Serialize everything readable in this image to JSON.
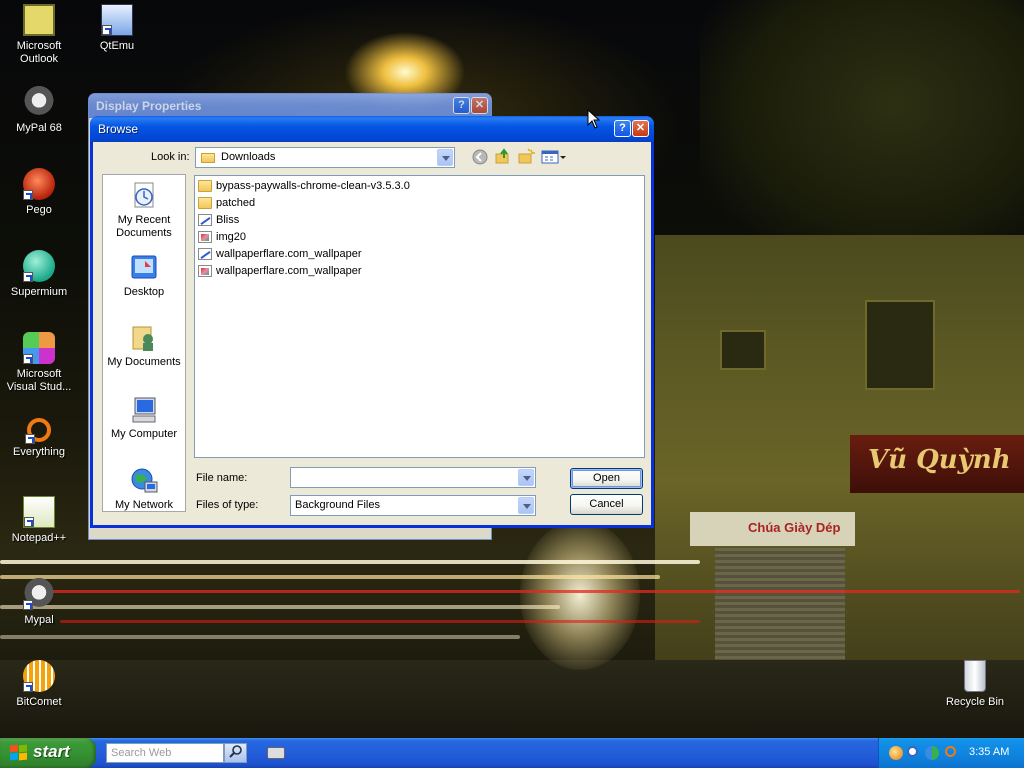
{
  "desktop": {
    "icons": [
      {
        "label": "Microsoft\nOutlook"
      },
      {
        "label": "QtEmu"
      },
      {
        "label": "MyPal 68"
      },
      {
        "label": "Pego"
      },
      {
        "label": "Supermium"
      },
      {
        "label": "Microsoft\nVisual Stud..."
      },
      {
        "label": "Everything"
      },
      {
        "label": "Notepad++"
      },
      {
        "label": "Mypal"
      },
      {
        "label": "BitComet"
      },
      {
        "label": "Recycle Bin"
      }
    ],
    "wallpaper_signs": {
      "shop_name": "Vũ Quỳnh",
      "shop_sign": "Chúa Giày Dép"
    }
  },
  "background_window": {
    "title": "Display Properties"
  },
  "dialog": {
    "title": "Browse",
    "help_btn": "?",
    "close_btn": "✕",
    "look_in_label": "Look in:",
    "look_in_value": "Downloads",
    "places": [
      {
        "label": "My Recent\nDocuments",
        "icon": "recent-documents-icon"
      },
      {
        "label": "Desktop",
        "icon": "desktop-icon"
      },
      {
        "label": "My Documents",
        "icon": "my-documents-icon"
      },
      {
        "label": "My Computer",
        "icon": "my-computer-icon"
      },
      {
        "label": "My Network",
        "icon": "my-network-icon"
      }
    ],
    "files": [
      {
        "name": "bypass-paywalls-chrome-clean-v3.5.3.0",
        "type": "folder"
      },
      {
        "name": "patched",
        "type": "folder"
      },
      {
        "name": "Bliss",
        "type": "paint"
      },
      {
        "name": "img20",
        "type": "image"
      },
      {
        "name": "wallpaperflare.com_wallpaper",
        "type": "paint"
      },
      {
        "name": "wallpaperflare.com_wallpaper",
        "type": "image"
      }
    ],
    "file_name_label": "File name:",
    "file_name_value": "",
    "file_type_label": "Files of type:",
    "file_type_value": "Background Files",
    "open_btn": "Open",
    "cancel_btn": "Cancel"
  },
  "taskbar": {
    "start_label": "start",
    "search_placeholder": "Search Web",
    "clock": "3:35 AM"
  },
  "colors": {
    "titlebar_blue": "#0456e4",
    "taskbar_blue": "#245edb",
    "start_green": "#348f30",
    "dialog_face": "#ece9d8"
  }
}
